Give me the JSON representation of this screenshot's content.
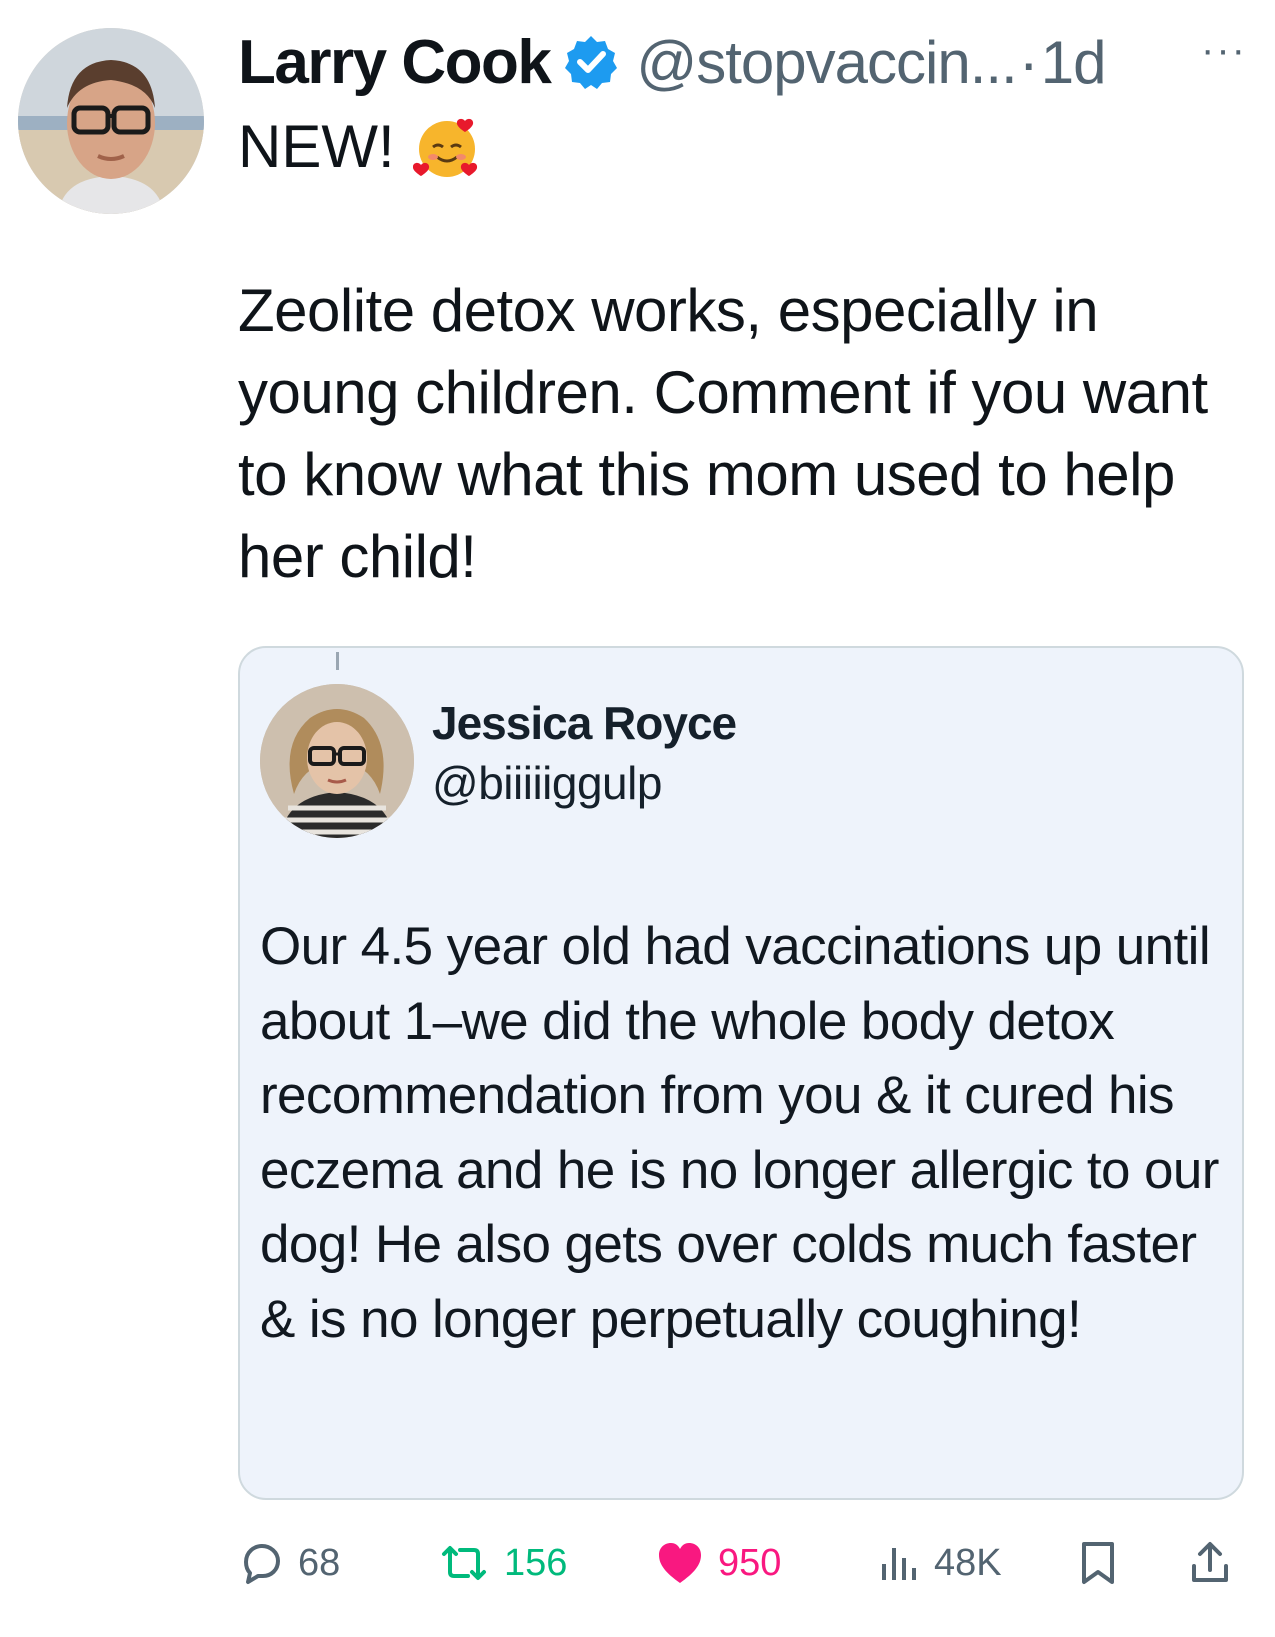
{
  "tweet": {
    "author_name": "Larry Cook",
    "handle": "@stopvaccin...",
    "separator": "·",
    "time": "1d",
    "more_label": "···",
    "headline": "NEW!",
    "body": "Zeolite detox works, especially in young children. Comment if you want to know what this mom used to help her child!"
  },
  "quoted": {
    "author_name": "Jessica Royce",
    "handle": "@biiiiiggulp",
    "text": "Our 4.5 year old had vaccinations up until about 1–we did the whole body detox recommendation from you & it cured his eczema and he is no longer allergic to our dog! He also gets over colds much faster & is no longer perpetually coughing!"
  },
  "actions": {
    "replies": "68",
    "retweets": "156",
    "likes": "950",
    "views": "48K"
  },
  "colors": {
    "verified": "#1d9bf0",
    "retweet": "#00ba7c",
    "like": "#f91880",
    "muted": "#536471",
    "quote_bg": "#eef3fb"
  },
  "icons": [
    "verified-badge-icon",
    "smiling-face-with-hearts-emoji",
    "reply-icon",
    "retweet-icon",
    "heart-icon",
    "views-icon",
    "bookmark-icon",
    "share-icon"
  ]
}
